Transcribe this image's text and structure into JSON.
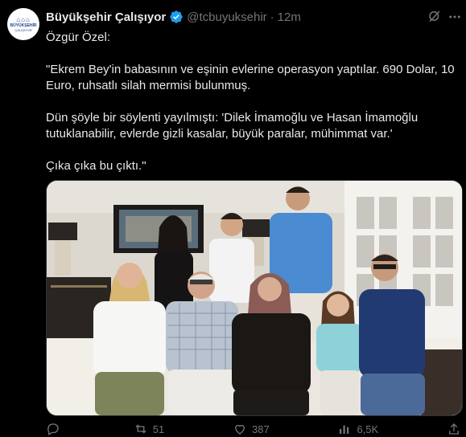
{
  "account": {
    "avatar_text_1": "BÜYÜKŞEHİR",
    "avatar_text_2": "ÇALIŞIYOR",
    "name": "Büyükşehir Çalışıyor",
    "handle": "@tcbuyuksehir",
    "separator": "·",
    "time": "12m"
  },
  "tweet": {
    "paragraphs": [
      "Özgür Özel:",
      "\"Ekrem Bey'in babasının ve eşinin evlerine operasyon yaptılar. 690 Dolar, 10 Euro, ruhsatlı silah mermisi bulunmuş.",
      "Dün şöyle bir söylenti yayılmıştı: 'Dilek İmamoğlu ve Hasan İmamoğlu tutuklanabilir, evlerde gizli kasalar, büyük paralar, mühimmat var.'",
      "Çıka çıka bu çıktı.\""
    ]
  },
  "actions": {
    "replies": "",
    "reposts": "51",
    "likes": "387",
    "views": "6,5K"
  },
  "icons": {
    "verified": "verified-badge-icon",
    "grok": "grok-icon",
    "more": "more-icon"
  },
  "colors": {
    "background": "#000000",
    "text": "#e7e9ea",
    "muted": "#71767b",
    "verified": "#1d9bf0"
  }
}
